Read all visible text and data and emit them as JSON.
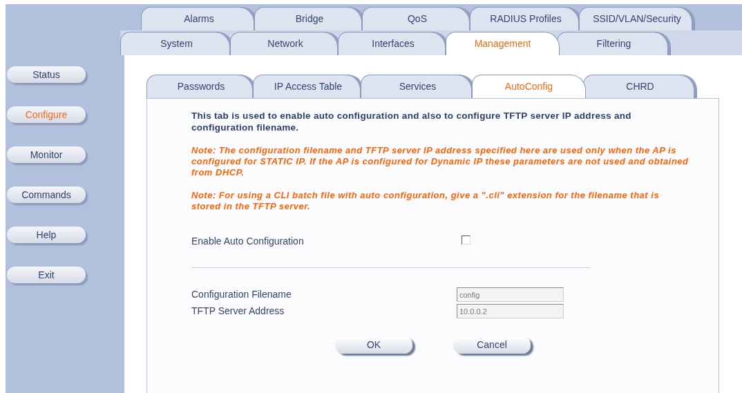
{
  "sidebar": {
    "items": [
      {
        "label": "Status",
        "selected": false
      },
      {
        "label": "Configure",
        "selected": true
      },
      {
        "label": "Monitor",
        "selected": false
      },
      {
        "label": "Commands",
        "selected": false
      },
      {
        "label": "Help",
        "selected": false
      },
      {
        "label": "Exit",
        "selected": false
      }
    ]
  },
  "tab_rows": [
    {
      "tabs": [
        {
          "label": "Alarms",
          "selected": false
        },
        {
          "label": "Bridge",
          "selected": false
        },
        {
          "label": "QoS",
          "selected": false
        },
        {
          "label": "RADIUS Profiles",
          "selected": false
        },
        {
          "label": "SSID/VLAN/Security",
          "selected": false
        }
      ]
    },
    {
      "tabs": [
        {
          "label": "System",
          "selected": false
        },
        {
          "label": "Network",
          "selected": false
        },
        {
          "label": "Interfaces",
          "selected": false
        },
        {
          "label": "Management",
          "selected": true
        },
        {
          "label": "Filtering",
          "selected": false
        }
      ]
    }
  ],
  "subtabs": [
    {
      "label": "Passwords",
      "selected": false
    },
    {
      "label": "IP Access Table",
      "selected": false
    },
    {
      "label": "Services",
      "selected": false
    },
    {
      "label": "AutoConfig",
      "selected": true
    },
    {
      "label": "CHRD",
      "selected": false
    }
  ],
  "intro": "This tab is used to enable auto configuration and also to configure TFTP server IP address and configuration filename.",
  "notes": [
    "Note: The configuration filename and TFTP server IP address specified here are used only when the AP is configured for STATIC IP. If the AP is configured for Dynamic IP these parameters are not used and obtained from DHCP.",
    "Note: For using a CLI batch file with auto configuration, give a \".cli\" extension for the filename that is stored in the TFTP server."
  ],
  "enable_auto_configuration": {
    "label": "Enable Auto Configuration",
    "checked": false
  },
  "fields": [
    {
      "label": "Configuration Filename",
      "value": "config",
      "disabled": true
    },
    {
      "label": "TFTP Server Address",
      "value": "10.0.0.2",
      "disabled": true
    }
  ],
  "buttons": [
    "OK",
    "Cancel"
  ]
}
